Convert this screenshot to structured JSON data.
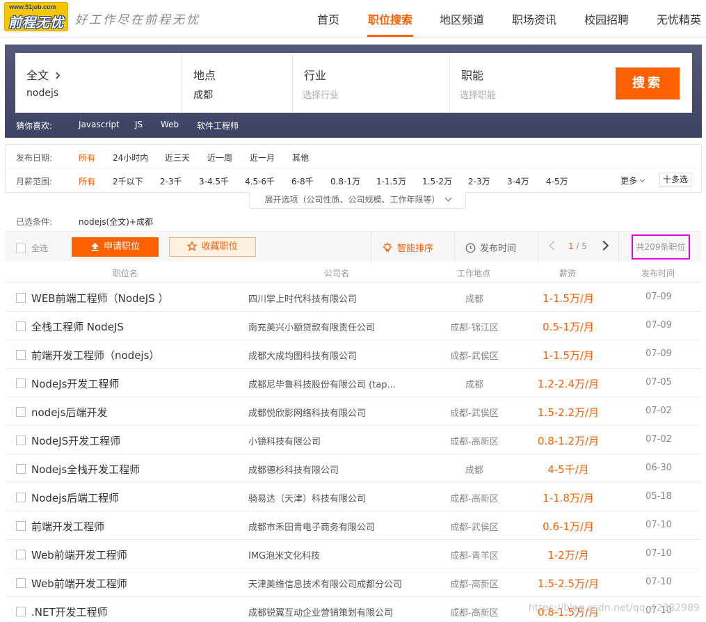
{
  "header": {
    "logo_url_text": "www.51job.com",
    "logo_text": "前程无忧",
    "slogan": "好工作尽在前程无忧",
    "nav": [
      "首页",
      "职位搜索",
      "地区频道",
      "职场资讯",
      "校园招聘",
      "无忧精英"
    ],
    "active_nav": "职位搜索"
  },
  "search": {
    "keyword_label": "全文",
    "keyword_value": "nodejs",
    "location_label": "地点",
    "location_value": "成都",
    "industry_label": "行业",
    "industry_placeholder": "选择行业",
    "function_label": "职能",
    "function_placeholder": "选择职能",
    "button": "搜索",
    "guess_label": "猜你喜欢:",
    "guess_tags": [
      "Javascript",
      "JS",
      "Web",
      "软件工程师"
    ]
  },
  "filters": {
    "date_label": "发布日期:",
    "date_options": [
      "所有",
      "24小时内",
      "近三天",
      "近一周",
      "近一月",
      "其他"
    ],
    "salary_label": "月薪范围:",
    "salary_options": [
      "所有",
      "2千以下",
      "2-3千",
      "3-4.5千",
      "4.5-6千",
      "6-8千",
      "0.8-1万",
      "1-1.5万",
      "1.5-2万",
      "2-3万",
      "3-4万",
      "4-5万"
    ],
    "more": "更多",
    "multi": "十多选",
    "expand": "展开选项（公司性质、公司规模、工作年限等）",
    "selected_label": "已选条件:",
    "selected_value": "nodejs(全文)+成都"
  },
  "toolbar": {
    "select_all": "全选",
    "apply": "申请职位",
    "favorite": "收藏职位",
    "smart_sort": "智能排序",
    "publish_time": "发布时间",
    "page_current": "1",
    "page_total": "/ 5",
    "total": "共209条职位"
  },
  "table": {
    "headers": [
      "职位名",
      "公司名",
      "工作地点",
      "薪资",
      "发布时间"
    ],
    "rows": [
      {
        "title": "WEB前端工程师（NodeJS ）",
        "company": "四川掌上时代科技有限公司",
        "location": "成都",
        "salary": "1-1.5万/月",
        "date": "07-09"
      },
      {
        "title": "全栈工程师 NodeJS",
        "company": "南充美兴小额贷款有限责任公司",
        "location": "成都-锦江区",
        "salary": "0.5-1万/月",
        "date": "07-09"
      },
      {
        "title": "前端开发工程师（nodejs）",
        "company": "成都大成均图科技有限公司",
        "location": "成都-武侯区",
        "salary": "1-1.5万/月",
        "date": "07-09"
      },
      {
        "title": "NodeJs开发工程师",
        "company": "成都尼毕鲁科技股份有限公司 (tap...",
        "location": "成都",
        "salary": "1.2-2.4万/月",
        "date": "07-05"
      },
      {
        "title": "nodejs后端开发",
        "company": "成都悦欣影网络科技有限公司",
        "location": "成都-武侯区",
        "salary": "1.5-2.2万/月",
        "date": "07-02"
      },
      {
        "title": "NodeJS开发工程师",
        "company": "小镜科技有限公司",
        "location": "成都-高新区",
        "salary": "0.8-1.2万/月",
        "date": "07-02"
      },
      {
        "title": "Nodejs全栈开发工程师",
        "company": "成都德杉科技有限公司",
        "location": "成都",
        "salary": "4-5千/月",
        "date": "06-30"
      },
      {
        "title": "Nodejs后端工程师",
        "company": "骑易达（天津）科技有限公司",
        "location": "成都-高新区",
        "salary": "1-1.8万/月",
        "date": "05-18"
      },
      {
        "title": "前端开发工程师",
        "company": "成都市禾田青电子商务有限公司",
        "location": "成都-武侯区",
        "salary": "0.6-1万/月",
        "date": "07-10"
      },
      {
        "title": "Web前端开发工程师",
        "company": "IMG泡米文化科技",
        "location": "成都-青羊区",
        "salary": "1-2万/月",
        "date": "07-10"
      },
      {
        "title": "Web前端开发工程师",
        "company": "天津美维信息技术有限公司成都分公司",
        "location": "成都-高新区",
        "salary": "1.5-2.5万/月",
        "date": "07-10"
      },
      {
        "title": ".NET开发工程师",
        "company": "成都锐翼互动企业营销策划有限公司",
        "location": "成都-高新区",
        "salary": "0.8-1.5万/月",
        "date": "07-10"
      }
    ]
  },
  "watermark": "https://blog.csdn.net/qq_42382989",
  "colors": {
    "accent": "#ff6000",
    "panel": "#494d6e",
    "highlight_box": "#e000e0"
  }
}
